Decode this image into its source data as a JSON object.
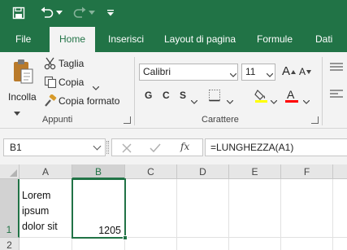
{
  "qat": {
    "save_icon": "save-icon",
    "undo_icon": "undo-icon",
    "redo_icon": "redo-icon",
    "customize_icon": "customize-qat-icon"
  },
  "tabs": [
    {
      "label": "File"
    },
    {
      "label": "Home"
    },
    {
      "label": "Inserisci"
    },
    {
      "label": "Layout di pagina"
    },
    {
      "label": "Formule"
    },
    {
      "label": "Dati"
    }
  ],
  "ribbon": {
    "clipboard": {
      "paste_label": "Incolla",
      "cut_label": "Taglia",
      "copy_label": "Copia",
      "format_painter_label": "Copia formato",
      "group_label": "Appunti"
    },
    "font": {
      "font_name": "Calibri",
      "font_size": "11",
      "bold": "G",
      "italic": "C",
      "underline": "S",
      "grow_font": "A",
      "shrink_font": "A",
      "font_color_letter": "A",
      "group_label": "Carattere"
    }
  },
  "formula_bar": {
    "name_box": "B1",
    "fx_label": "fx",
    "formula": "=LUNGHEZZA(A1)"
  },
  "grid": {
    "columns": [
      "A",
      "B",
      "C",
      "D",
      "E",
      "F"
    ],
    "rows": [
      "1",
      "2"
    ],
    "cells": {
      "A1": "Lorem\nipsum\ndolor sit\namet,",
      "B1": "1205"
    },
    "selected_cell": "B1"
  },
  "colors": {
    "accent": "#217346",
    "highlight_yellow": "#ffff00",
    "font_red": "#ff0000"
  }
}
